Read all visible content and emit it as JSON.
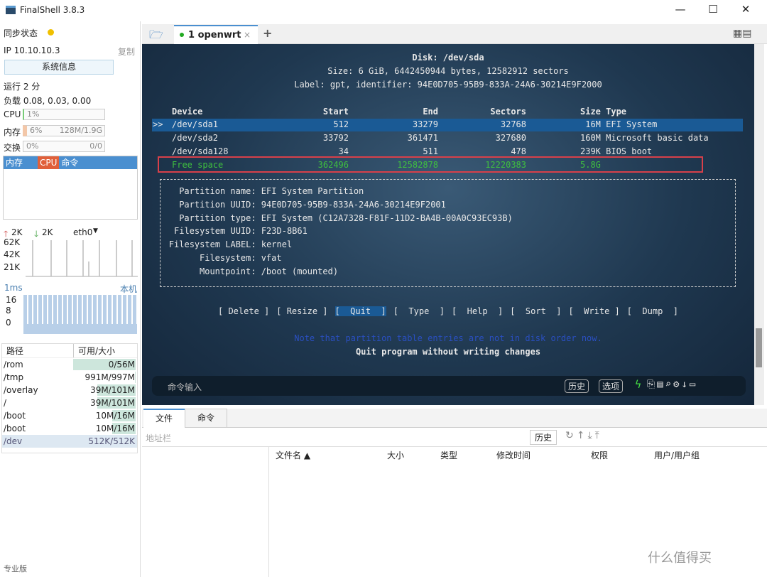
{
  "window": {
    "title": "FinalShell 3.8.3",
    "minimize": "—",
    "maximize": "☐",
    "close": "✕"
  },
  "sidebar": {
    "sync_label": "同步状态",
    "ip": "IP 10.10.10.3",
    "copy": "复制",
    "sysinfo_button": "系统信息",
    "uptime": "运行 2 分",
    "load": "负载 0.08, 0.03, 0.00",
    "cpu": {
      "label": "CPU",
      "value": "1%",
      "percent": 1
    },
    "mem": {
      "label": "内存",
      "value": "6%",
      "detail": "128M/1.9G",
      "percent": 6
    },
    "swap": {
      "label": "交换",
      "value": "0%",
      "detail": "0/0",
      "percent": 0
    },
    "proc_tabs": [
      "内存",
      "CPU",
      "命令"
    ],
    "net": {
      "up": "2K",
      "down": "2K",
      "iface": "eth0",
      "ticks": [
        "62K",
        "42K",
        "21K"
      ]
    },
    "ping": {
      "label": "1ms",
      "host": "本机",
      "ticks": [
        "16",
        "8",
        "0"
      ]
    },
    "disk": {
      "headers": [
        "路径",
        "可用/大小"
      ],
      "rows": [
        {
          "path": "/rom",
          "size": "0/56M",
          "used": 100
        },
        {
          "path": "/tmp",
          "size": "991M/997M",
          "used": 1
        },
        {
          "path": "/overlay",
          "size": "39M/101M",
          "used": 61
        },
        {
          "path": "/",
          "size": "39M/101M",
          "used": 61
        },
        {
          "path": "/boot",
          "size": "10M/16M",
          "used": 38
        },
        {
          "path": "/boot",
          "size": "10M/16M",
          "used": 38
        },
        {
          "path": "/dev",
          "size": "512K/512K",
          "used": 0
        }
      ]
    },
    "edition": "专业版"
  },
  "tabs": {
    "items": [
      {
        "label": "1 openwrt"
      }
    ],
    "add": "+"
  },
  "terminal": {
    "disk": "Disk: /dev/sda",
    "size": "Size: 6 GiB, 6442450944 bytes, 12582912 sectors",
    "label": "Label: gpt, identifier: 94E0D705-95B9-833A-24A6-30214E9F2000",
    "headers": [
      "Device",
      "Start",
      "End",
      "Sectors",
      "Size Type"
    ],
    "rows": [
      {
        "dev": "/dev/sda1",
        "start": "512",
        "end": "33279",
        "sectors": "32768",
        "type": " 16M EFI System"
      },
      {
        "dev": "/dev/sda2",
        "start": "33792",
        "end": "361471",
        "sectors": "327680",
        "type": "160M Microsoft basic data"
      },
      {
        "dev": "/dev/sda128",
        "start": "34",
        "end": "511",
        "sectors": "478",
        "type": "239K BIOS boot"
      },
      {
        "dev": "Free space",
        "start": "362496",
        "end": "12582878",
        "sectors": "12220383",
        "type": "5.8G"
      }
    ],
    "cursor": ">>",
    "info": [
      "Partition name: EFI System Partition",
      "Partition UUID: 94E0D705-95B9-833A-24A6-30214E9F2001",
      "Partition type: EFI System (C12A7328-F81F-11D2-BA4B-00A0C93EC93B)",
      "Filesystem UUID: F23D-8B61",
      "Filesystem LABEL: kernel",
      "Filesystem: vfat",
      "Mountpoint: /boot (mounted)"
    ],
    "menu": [
      "[ Delete ]",
      "[ Resize ]",
      "[  Quit  ]",
      "[  Type  ]",
      "[  Help  ]",
      "[  Sort  ]",
      "[  Write ]",
      "[  Dump  ]"
    ],
    "note": "Note that partition table entries are not in disk order now.",
    "hint": "Quit program without writing changes",
    "cmd_placeholder": "命令输入",
    "history": "历史",
    "options": "选项"
  },
  "files": {
    "tabs": [
      "文件",
      "命令"
    ],
    "address_placeholder": "地址栏",
    "history": "历史",
    "columns": [
      "文件名 ▲",
      "大小",
      "类型",
      "修改时间",
      "权限",
      "用户/用户组"
    ]
  },
  "watermark": "什么值得买"
}
